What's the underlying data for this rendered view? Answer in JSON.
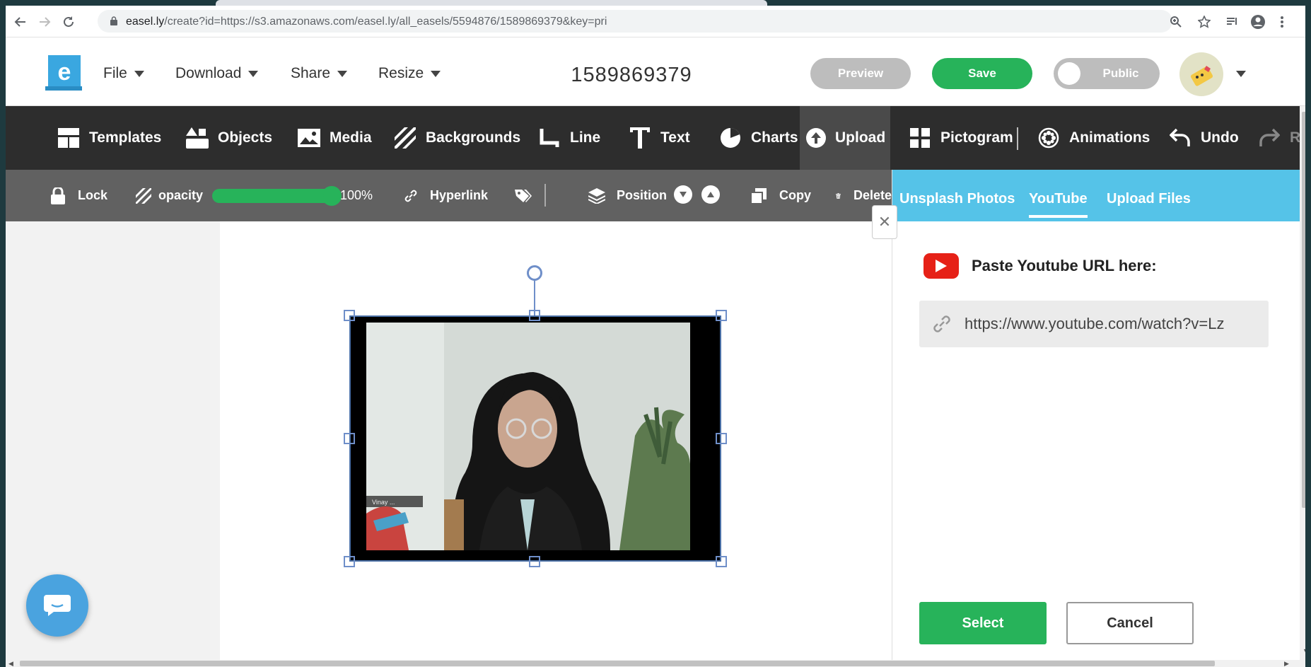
{
  "browser": {
    "url_host": "easel.ly",
    "url_path": "/create?id=https://s3.amazonaws.com/easel.ly/all_easels/5594876/1589869379&key=pri"
  },
  "header": {
    "menus": [
      "File",
      "Download",
      "Share",
      "Resize"
    ],
    "doc_title": "1589869379",
    "preview_label": "Preview",
    "save_label": "Save",
    "public_label": "Public"
  },
  "toolbar": {
    "items": [
      {
        "label": "Templates",
        "icon": "templates-icon"
      },
      {
        "label": "Objects",
        "icon": "objects-icon"
      },
      {
        "label": "Media",
        "icon": "image-icon"
      },
      {
        "label": "Backgrounds",
        "icon": "backgrounds-icon"
      },
      {
        "label": "Line",
        "icon": "line-icon"
      },
      {
        "label": "Text",
        "icon": "text-icon"
      },
      {
        "label": "Charts",
        "icon": "pie-chart-icon"
      },
      {
        "label": "Upload",
        "icon": "upload-icon",
        "active": true
      },
      {
        "label": "Pictogram",
        "icon": "pictogram-icon"
      },
      {
        "label": "Animations",
        "icon": "film-reel-icon"
      },
      {
        "label": "Undo",
        "icon": "undo-icon"
      },
      {
        "label": "Re",
        "icon": "redo-icon"
      }
    ]
  },
  "subtoolbar": {
    "lock_label": "Lock",
    "opacity_label": "opacity",
    "opacity_value": "100%",
    "opacity_fraction": 1.0,
    "hyperlink_label": "Hyperlink",
    "position_label": "Position",
    "copy_label": "Copy",
    "delete_label": "Delete"
  },
  "panel": {
    "tabs": [
      "Unsplash Photos",
      "YouTube",
      "Upload Files"
    ],
    "selected_tab": "YouTube",
    "heading": "Paste Youtube URL here:",
    "url_value": "https://www.youtube.com/watch?v=Lz",
    "select_label": "Select",
    "cancel_label": "Cancel"
  },
  "video_overlay_text": "Vinay ...",
  "colors": {
    "accent_green": "#27b35a",
    "panel_blue": "#55c3e8",
    "toolbar_dark": "#2d2d2d",
    "subtoolbar_gray": "#616161",
    "youtube_red": "#e62117"
  }
}
